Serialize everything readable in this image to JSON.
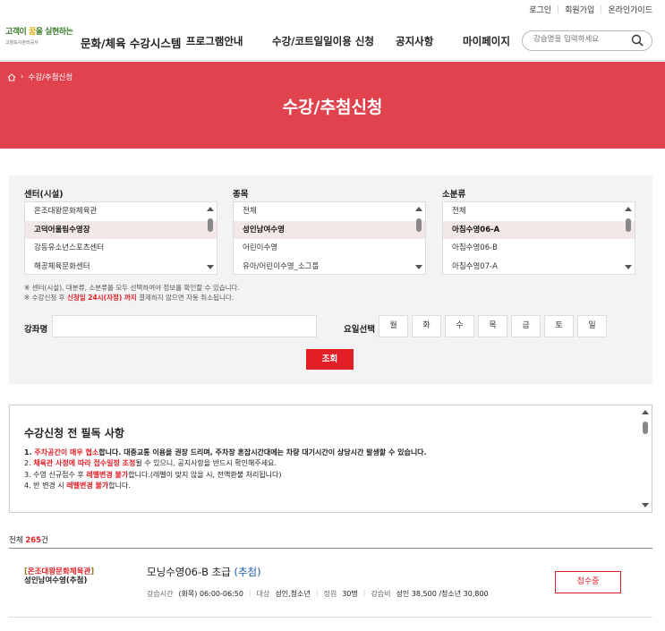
{
  "util_links": {
    "login": "로그인",
    "signup": "회원가입",
    "guide": "온라인가이드",
    "sep": "|"
  },
  "logo": {
    "line1a": "고객이 ",
    "line1b": "꿈",
    "line1c": "을 실현하는",
    "line2": "고양도시관리공사"
  },
  "site_title": "문화/체육 수강시스템",
  "nav": [
    "프로그램안내",
    "수강/코트일일이용 신청",
    "공지사항",
    "마이페이지"
  ],
  "search": {
    "placeholder": "강습명을 입력하세요"
  },
  "breadcrumb": {
    "current": "수강/추첨신청",
    "sep": "›"
  },
  "page_title": "수강/추첨신청",
  "filters": {
    "center": {
      "label": "센터(시설)",
      "options": [
        "온조대왕문화체육관",
        "고덕어울림수영장",
        "강동유소년스포츠센터",
        "해공체육문화센터"
      ],
      "selected_index": 1
    },
    "category": {
      "label": "종목",
      "options": [
        "전체",
        "성인남여수영",
        "어린이수영",
        "유아/어린이수영_소그룹"
      ],
      "selected_index": 1
    },
    "subcategory": {
      "label": "소분류",
      "options": [
        "전체",
        "아침수영06-A",
        "아침수영06-B",
        "아침수영07-A"
      ],
      "selected_index": 1
    },
    "notes": {
      "line1": "※ 센터(시설), 대분류, 소분류를 모두 선택하여야 정보를 확인할 수 있습니다.",
      "line2a": "※ 수강신청 후 ",
      "line2b": "신청일 24시(자정) 까지",
      "line2c": " 결제하지 않으면 자동 취소됩니다."
    },
    "course_label": "강좌명",
    "course_value": "",
    "day_label": "요일선택",
    "days": [
      "월",
      "화",
      "수",
      "목",
      "금",
      "토",
      "일"
    ],
    "search_button": "조회"
  },
  "notice": {
    "title": "수강신청 전 필독 사항",
    "l1a": "1. ",
    "l1b": "주차공간이 매우 협소",
    "l1c": "합니다. 대중교통 이용을 권장 드리며, 주차장 혼잡시간대에는 차량 대기시간이 상당시간 발생할 수 있습니다.",
    "l2a": "2. ",
    "l2b": "체육관 사정에 따라 접수일정 조정",
    "l2c": "될 수 있으니, 공지사항을 반드시 확인해주세요.",
    "l3a": "3. 수영 신규접수 후 ",
    "l3b": "레벨변경 불가",
    "l3c": "합니다.(레벨이 맞지 않을 시, 전액환불 처리됩니다)",
    "l4a": "4. 반 변경 시 ",
    "l4b": "레벨변경 불가",
    "l4c": "합니다."
  },
  "total": {
    "prefix": "전체 ",
    "count": "265",
    "suffix": "건"
  },
  "results": [
    {
      "center": "온조대왕문화체육관",
      "facility": "성인남여수영(추첨)",
      "title": "모닝수영06-B  초급",
      "lottery": "(추첨)",
      "time_label": "강습시간",
      "time": "(화목) 06:00-06:50",
      "target_label": "대상",
      "target": "성인,청소년",
      "capacity_label": "정원",
      "capacity": "30명",
      "fee_label": "강습비",
      "fee": "성인 38,500 /청소년 30,800",
      "button": "접수중"
    }
  ],
  "colors": {
    "accent": "#e0434d",
    "red": "#e21f26",
    "link_blue": "#1e5aa8",
    "panel_bg": "#f3f3f3"
  }
}
